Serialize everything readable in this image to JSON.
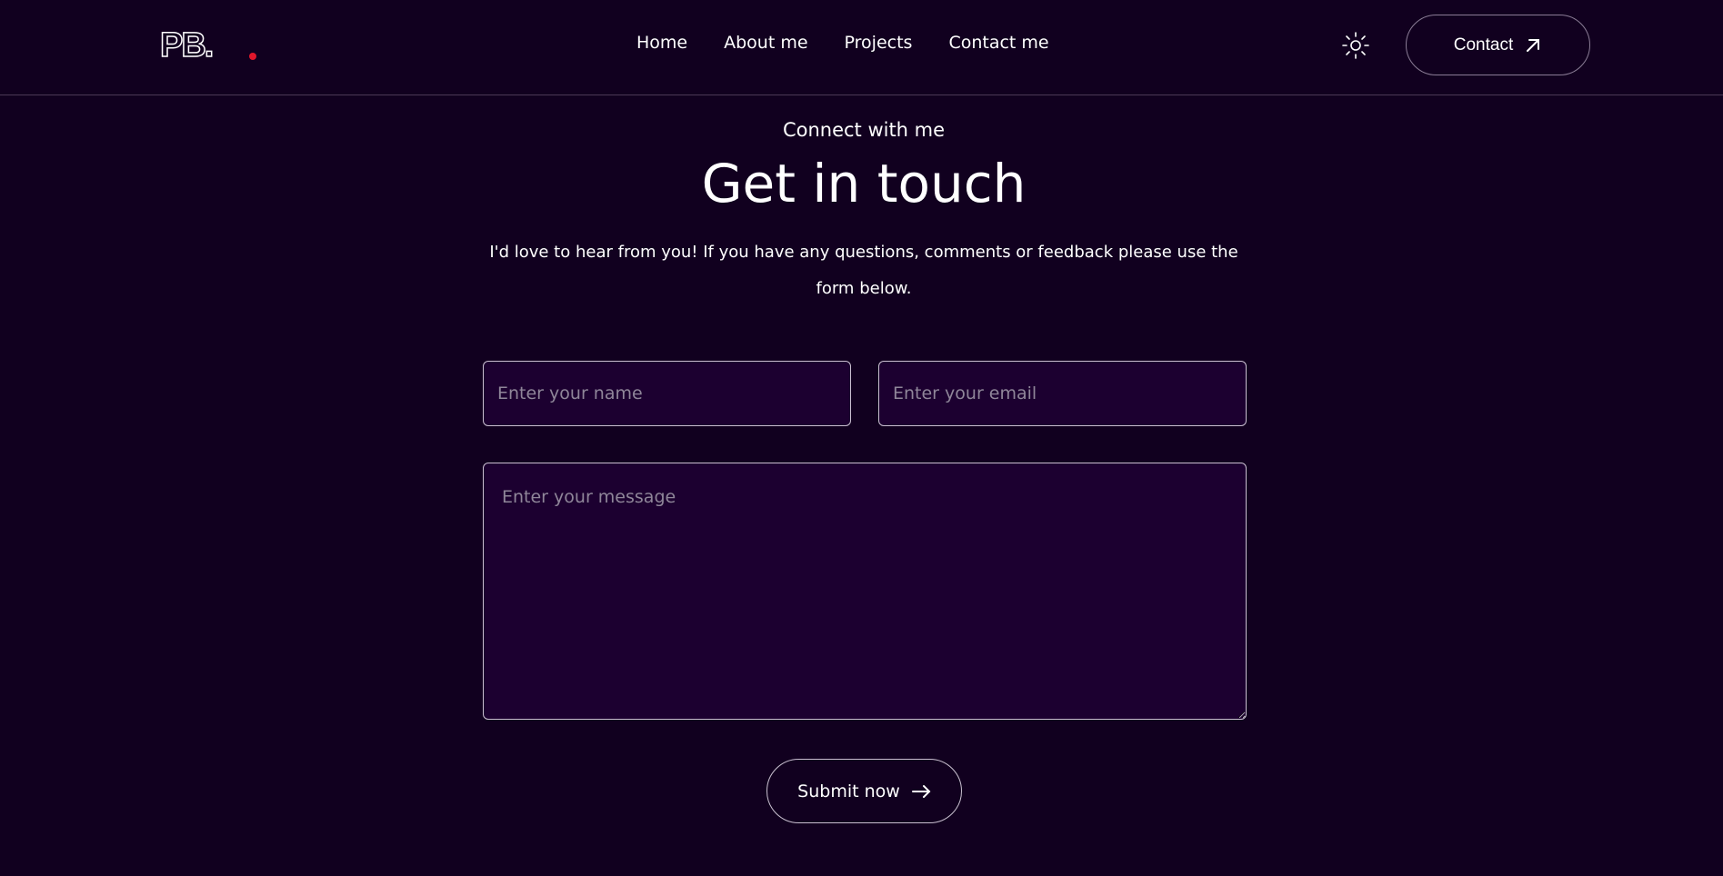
{
  "header": {
    "logo_text": "PB.",
    "nav": [
      {
        "label": "Home"
      },
      {
        "label": "About me"
      },
      {
        "label": "Projects"
      },
      {
        "label": "Contact me"
      }
    ],
    "theme_icon": "sun-icon",
    "contact_label": "Contact",
    "contact_icon": "arrow-up-right-icon"
  },
  "section": {
    "eyebrow": "Connect with me",
    "title": "Get in touch",
    "intro": "I'd love to hear from you! If you have any questions, comments or feedback please use the form below."
  },
  "form": {
    "name_placeholder": "Enter your name",
    "email_placeholder": "Enter your email",
    "message_placeholder": "Enter your message",
    "name_value": "",
    "email_value": "",
    "message_value": "",
    "submit_label": "Submit now",
    "submit_icon": "arrow-right-icon"
  },
  "colors": {
    "background": "#11001f",
    "field_background": "#1c0030",
    "logo_dot": "#e0162b",
    "text": "#ffffff"
  }
}
